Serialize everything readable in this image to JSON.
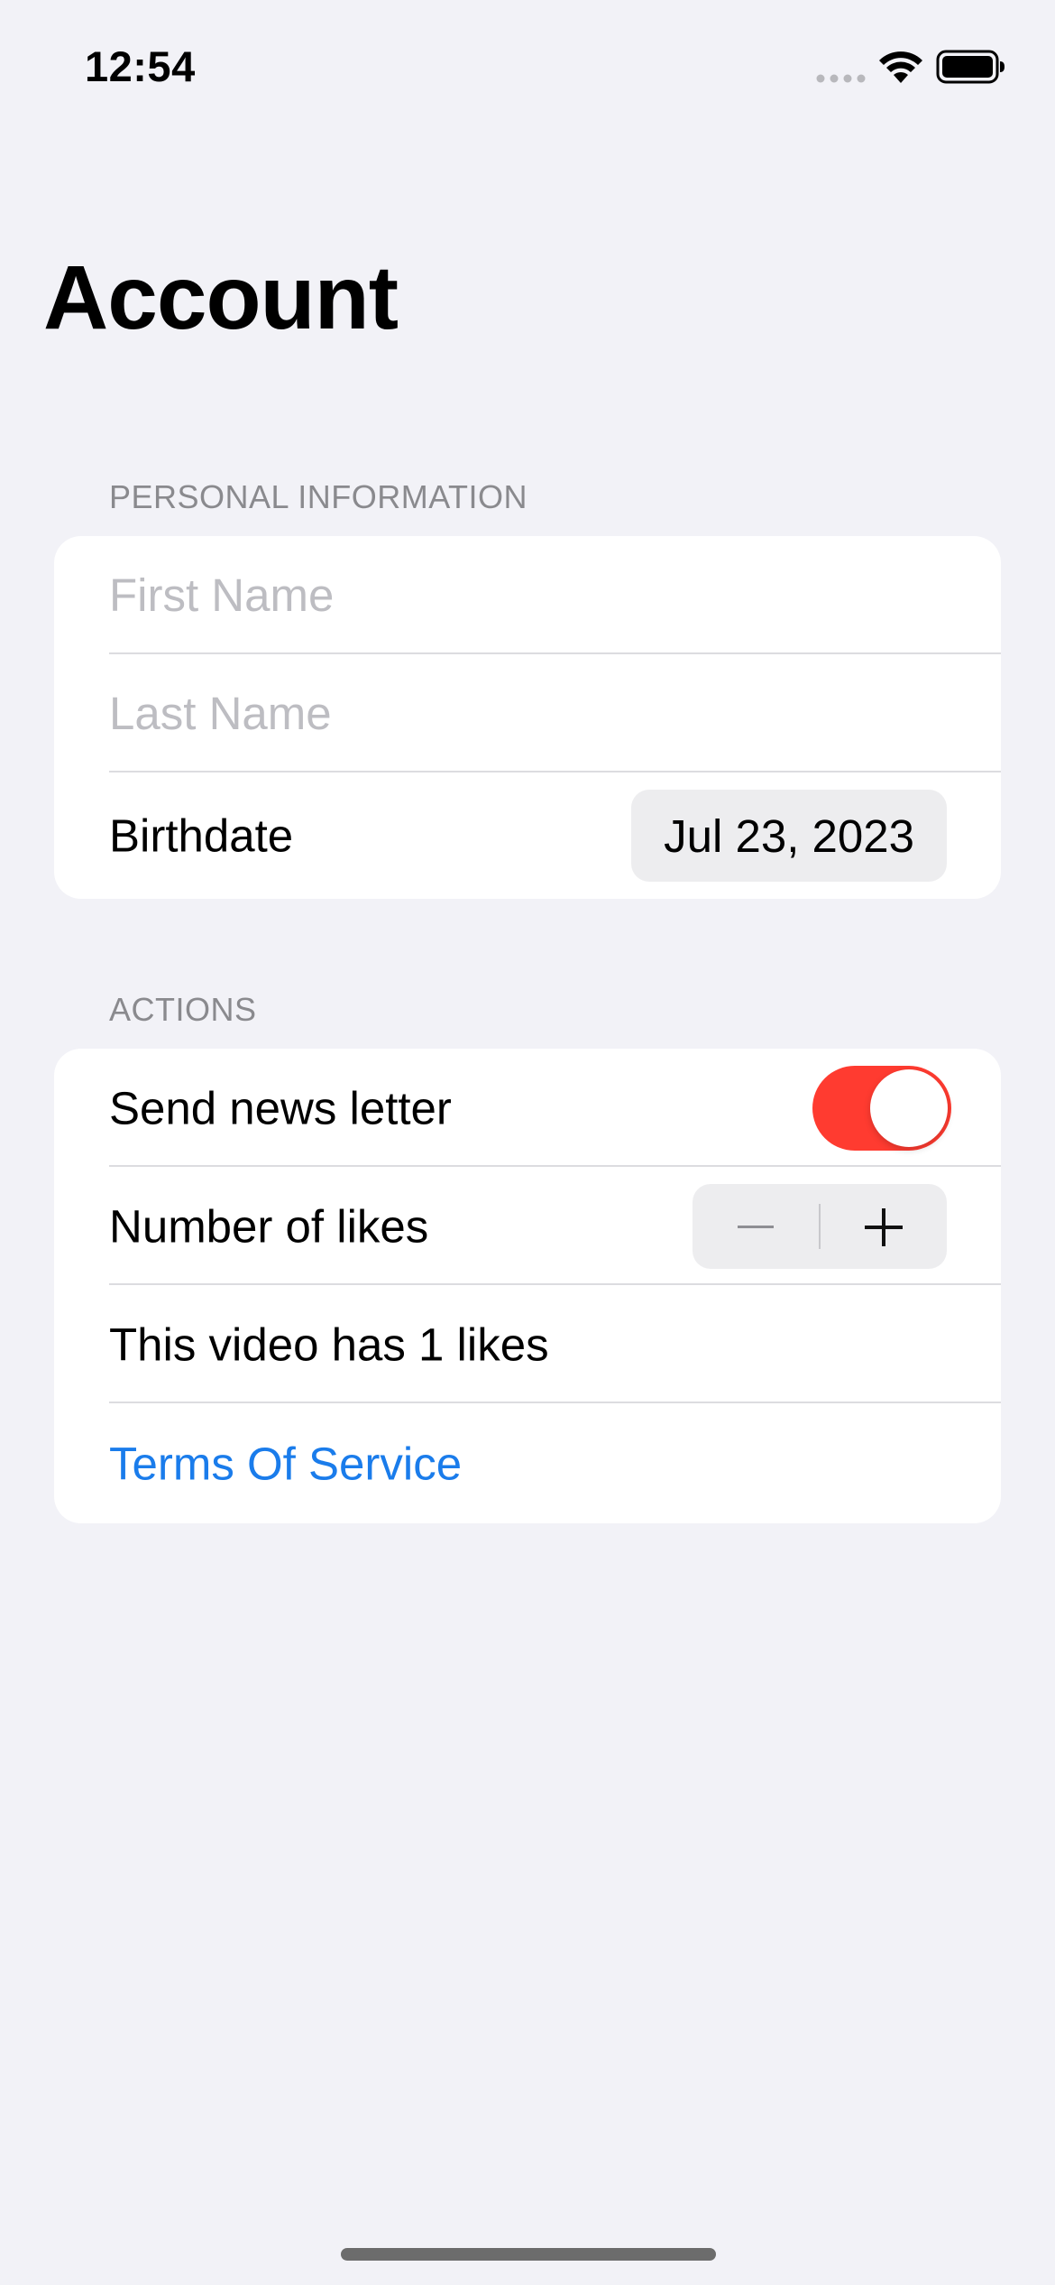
{
  "status_bar": {
    "time": "12:54",
    "signal_icon": "cellular-signal-icon",
    "wifi_icon": "wifi-icon",
    "battery_icon": "battery-icon"
  },
  "title": "Account",
  "sections": {
    "personal": {
      "header": "PERSONAL INFORMATION",
      "first_name": {
        "placeholder": "First Name",
        "value": ""
      },
      "last_name": {
        "placeholder": "Last Name",
        "value": ""
      },
      "birthdate": {
        "label": "Birthdate",
        "value": "Jul 23, 2023"
      }
    },
    "actions": {
      "header": "ACTIONS",
      "newsletter": {
        "label": "Send news letter",
        "on": true
      },
      "likes": {
        "label": "Number of likes",
        "minus_icon": "minus-icon",
        "plus_icon": "plus-icon"
      },
      "likes_text": "This video has 1 likes",
      "terms_link": "Terms Of Service"
    }
  },
  "colors": {
    "background": "#F2F2F7",
    "toggle_on": "#FF3B30",
    "link": "#1A7CEB",
    "section_header": "#8A8A8E"
  }
}
